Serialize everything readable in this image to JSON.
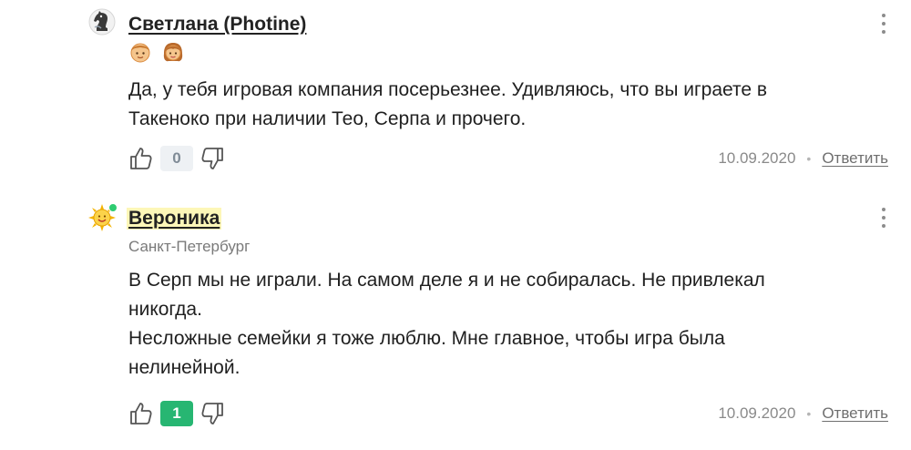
{
  "comments": [
    {
      "author": "Светлана (Photine)",
      "avatar_icon": "chess-knight-avatar-icon",
      "badges": [
        "boy-face-emoji-icon",
        "girl-face-emoji-icon"
      ],
      "text": "Да, у тебя игровая компания посерьезнее. Удивляюсь, что вы играете в\nТакеноко при наличии Тео, Серпа и прочего.",
      "score": "0",
      "date": "10.09.2020",
      "reply_label": "Ответить",
      "separator": "•"
    },
    {
      "author": "Вероника",
      "avatar_icon": "sun-avatar-icon",
      "online_color": "#2ecc71",
      "highlight_color": "#fdf7b8",
      "city": "Санкт-Петербург",
      "text": "В Серп мы не играли. На самом деле я и не собиралась. Не привлекал\nникогда.\nНесложные семейки я тоже люблю. Мне главное, чтобы игра была\nнелинейной.",
      "score": "1",
      "score_color": "#27b672",
      "date": "10.09.2020",
      "reply_label": "Ответить",
      "separator": "•"
    }
  ]
}
